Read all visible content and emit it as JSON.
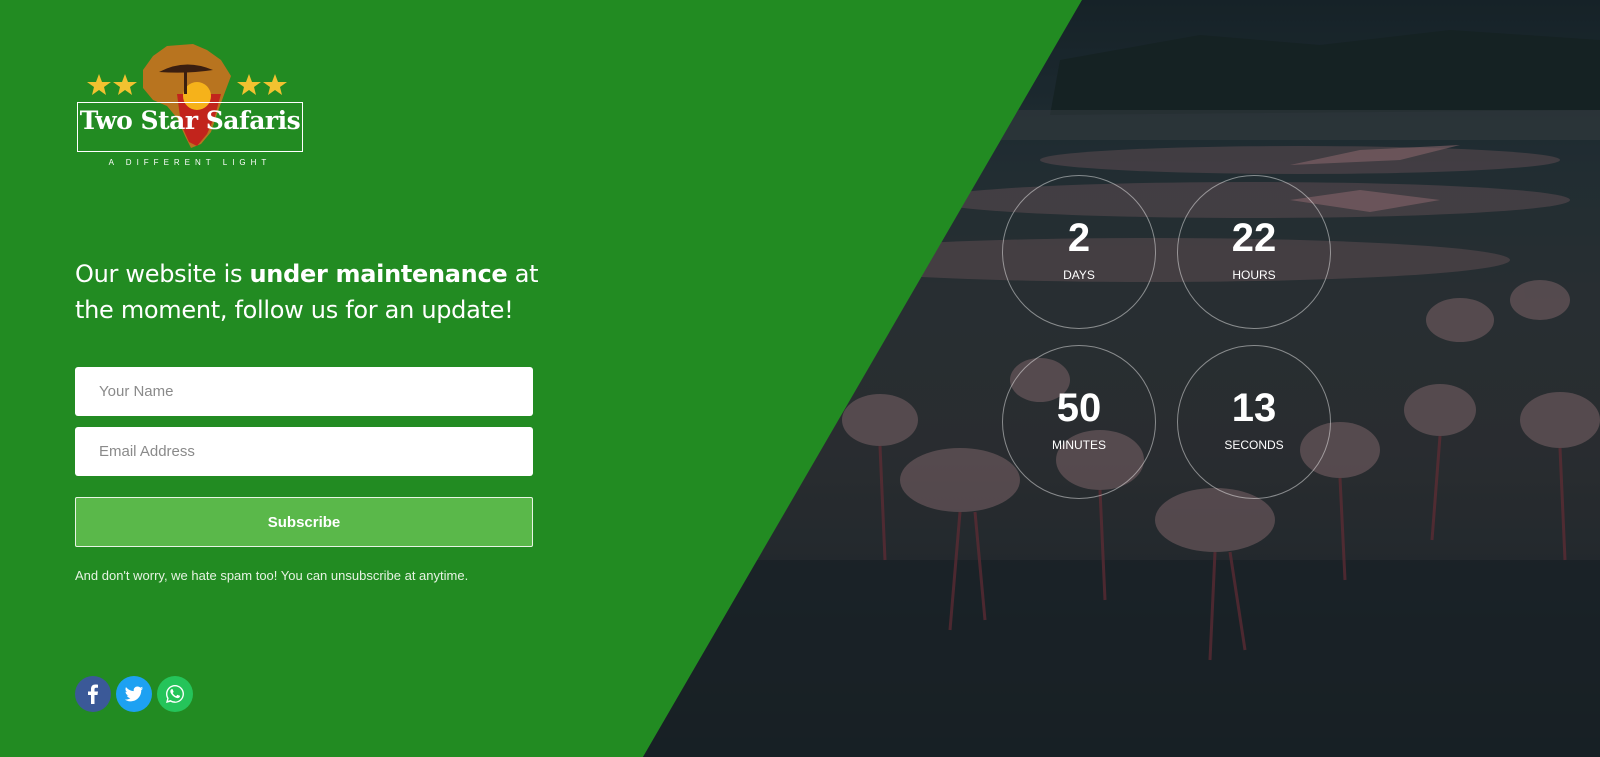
{
  "logo": {
    "name": "Two Star Safaris",
    "tagline": "A DIFFERENT LIGHT"
  },
  "headline": {
    "before": "Our website is ",
    "bold": "under maintenance",
    "after": " at the moment, follow us for an update!"
  },
  "form": {
    "name_placeholder": "Your Name",
    "email_placeholder": "Email Address",
    "subscribe_label": "Subscribe",
    "note": "And don't worry, we hate spam too! You can unsubscribe at anytime."
  },
  "socials": [
    {
      "icon": "facebook-icon",
      "color": "#3b5998"
    },
    {
      "icon": "twitter-icon",
      "color": "#1da1f2"
    },
    {
      "icon": "whatsapp-icon",
      "color": "#25c45a"
    }
  ],
  "countdown": {
    "days": {
      "value": "2",
      "label": "DAYS"
    },
    "hours": {
      "value": "22",
      "label": "HOURS"
    },
    "minutes": {
      "value": "50",
      "label": "MINUTES"
    },
    "seconds": {
      "value": "13",
      "label": "SECONDS"
    }
  },
  "colors": {
    "background": "#228b22",
    "subscribe_button": "#5ab84a",
    "star": "#f2c230"
  }
}
